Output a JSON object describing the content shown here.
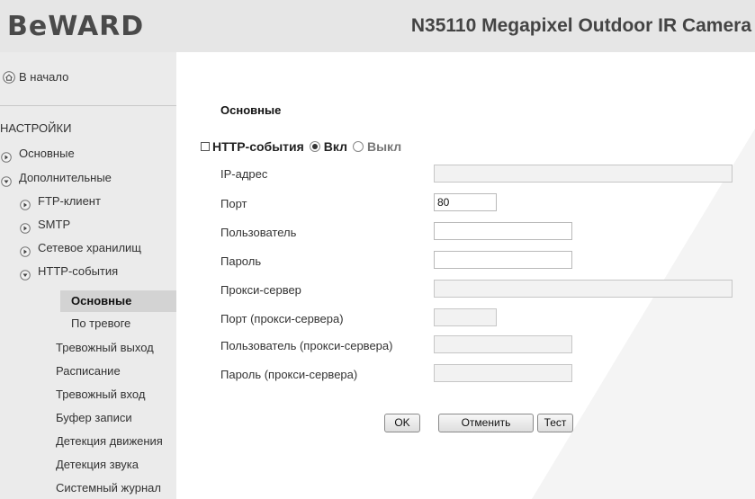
{
  "header": {
    "logo": "BeWARD",
    "product_title": "N35110 Megapixel Outdoor IR Camera"
  },
  "sidebar": {
    "home": "В начало",
    "heading": "НАСТРОЙКИ",
    "items": [
      {
        "label": "Основные",
        "arrow": "right"
      },
      {
        "label": "Дополнительные",
        "arrow": "down"
      },
      {
        "label": "FTP-клиент",
        "arrow": "right"
      },
      {
        "label": "SMTP",
        "arrow": "right"
      },
      {
        "label": "Сетевое хранилищ",
        "arrow": "right"
      },
      {
        "label": "HTTP-события",
        "arrow": "down"
      },
      {
        "label": "Основные",
        "active": true
      },
      {
        "label": "По тревоге"
      },
      {
        "label": "Тревожный выход"
      },
      {
        "label": "Расписание"
      },
      {
        "label": "Тревожный вход"
      },
      {
        "label": "Буфер записи"
      },
      {
        "label": "Детекция движения"
      },
      {
        "label": "Детекция звука"
      },
      {
        "label": "Системный журнал"
      }
    ]
  },
  "main": {
    "section_title": "Основные",
    "events": {
      "label": "HTTP-события",
      "on_label": "Вкл",
      "off_label": "Выкл",
      "selected": "on"
    },
    "fields": [
      {
        "label": "IP-адрес",
        "value": ""
      },
      {
        "label": "Порт",
        "value": "80"
      },
      {
        "label": "Пользователь",
        "value": ""
      },
      {
        "label": "Пароль",
        "value": ""
      },
      {
        "label": "Прокси-сервер",
        "value": ""
      },
      {
        "label": "Порт (прокси-сервера)",
        "value": ""
      },
      {
        "label": "Пользователь (прокси-сервера)",
        "value": ""
      },
      {
        "label": "Пароль (прокси-сервера)",
        "value": ""
      }
    ],
    "buttons": {
      "ok": "OK",
      "cancel": "Отменить",
      "test": "Тест"
    }
  },
  "colors": {
    "header_bg": "#e6e6e6",
    "sidebar_bg": "#ebebeb",
    "active_item_bg": "#d3d3d3"
  },
  "icons": {
    "home": "home-icon",
    "arrow_right": "arrow-right-icon",
    "arrow_down": "arrow-down-icon"
  }
}
